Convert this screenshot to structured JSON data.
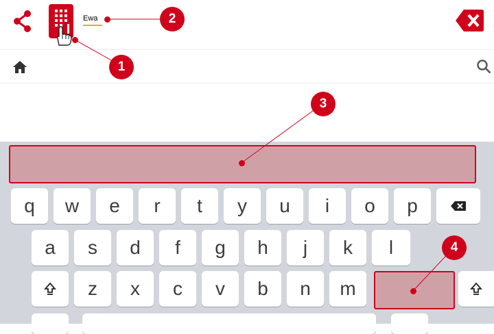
{
  "toolbar": {
    "input_value": "Ewa"
  },
  "keyboard": {
    "row1": [
      "q",
      "w",
      "e",
      "r",
      "t",
      "y",
      "u",
      "i",
      "o",
      "p"
    ],
    "row2": [
      "a",
      "s",
      "d",
      "f",
      "g",
      "h",
      "j",
      "k",
      "l"
    ],
    "row3": [
      "z",
      "x",
      "c",
      "v",
      "b",
      "n",
      "m"
    ]
  },
  "callouts": [
    "1",
    "2",
    "3",
    "4"
  ],
  "icons": {
    "share": "share-icon",
    "app": "app-icon",
    "cursor": "hand-cursor-icon",
    "clear": "clear-icon",
    "home": "home-icon",
    "search": "search-icon",
    "backspace": "backspace-icon",
    "shift": "shift-icon"
  },
  "colors": {
    "accent": "#d0021b",
    "highlight": "#cfa1a7",
    "input_underline": "#e7a53a",
    "keyboard_bg": "#d2d6dc"
  }
}
